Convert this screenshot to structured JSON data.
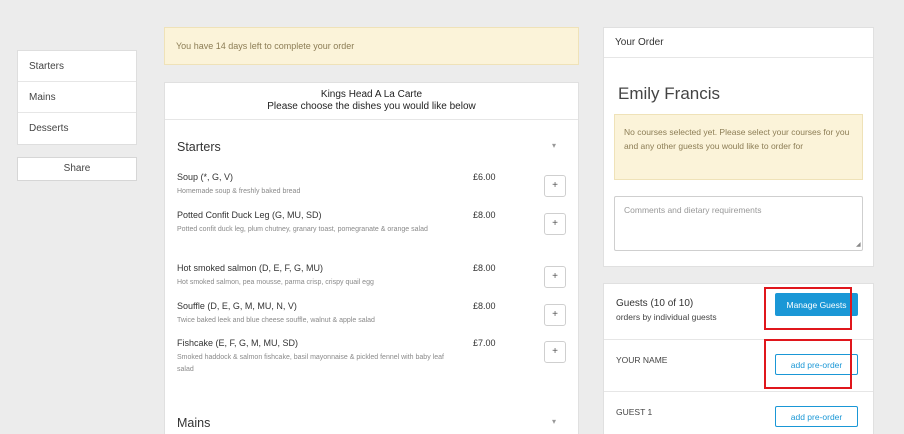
{
  "sidebar": {
    "items": [
      {
        "label": "Starters"
      },
      {
        "label": "Mains"
      },
      {
        "label": "Desserts"
      }
    ],
    "share_label": "Share"
  },
  "notice": {
    "text": "You have 14 days left to complete your order"
  },
  "menu": {
    "title": "Kings Head A La Carte",
    "subtitle": "Please choose the dishes you would like below",
    "add_symbol": "+",
    "caret_symbol": "▾",
    "sections": [
      {
        "title": "Starters",
        "dishes": [
          {
            "name": "Soup (*, G, V)",
            "desc": "Homemade soup & freshly baked bread",
            "price": "£6.00"
          },
          {
            "name": "Potted Confit Duck Leg (G, MU, SD)",
            "desc": "Potted confit duck leg, plum chutney, granary toast, pomegranate & orange salad",
            "price": "£8.00"
          },
          {
            "name": "Hot smoked salmon (D, E, F, G, MU)",
            "desc": "Hot smoked salmon, pea mousse, parma crisp, crispy quail egg",
            "price": "£8.00"
          },
          {
            "name": "Souffle (D, E, G, M, MU, N, V)",
            "desc": "Twice baked leek and blue cheese souffle, walnut & apple salad",
            "price": "£8.00"
          },
          {
            "name": "Fishcake (E, F, G, M, MU, SD)",
            "desc": "Smoked haddock & salmon fishcake, basil mayonnaise & pickled fennel with baby leaf salad",
            "price": "£7.00"
          }
        ]
      },
      {
        "title": "Mains",
        "dishes": []
      }
    ]
  },
  "order": {
    "heading": "Your Order",
    "guest_name": "Emily Francis",
    "no_courses_message": "No courses selected yet. Please select your courses for you and any other guests you would like to order for",
    "comments_placeholder": "Comments and dietary requirements",
    "comments_value": ""
  },
  "guests": {
    "title": "Guests (10 of 10)",
    "subtitle": "orders by individual guests",
    "manage_label": "Manage Guests",
    "rows": [
      {
        "label": "YOUR NAME",
        "button_label": "add pre-order"
      },
      {
        "label": "GUEST 1",
        "button_label": "add pre-order"
      }
    ]
  },
  "colors": {
    "accent": "#1a97d6",
    "notice_bg": "#fbf3d9",
    "highlight": "#e0161c",
    "page_bg": "#ececec"
  }
}
